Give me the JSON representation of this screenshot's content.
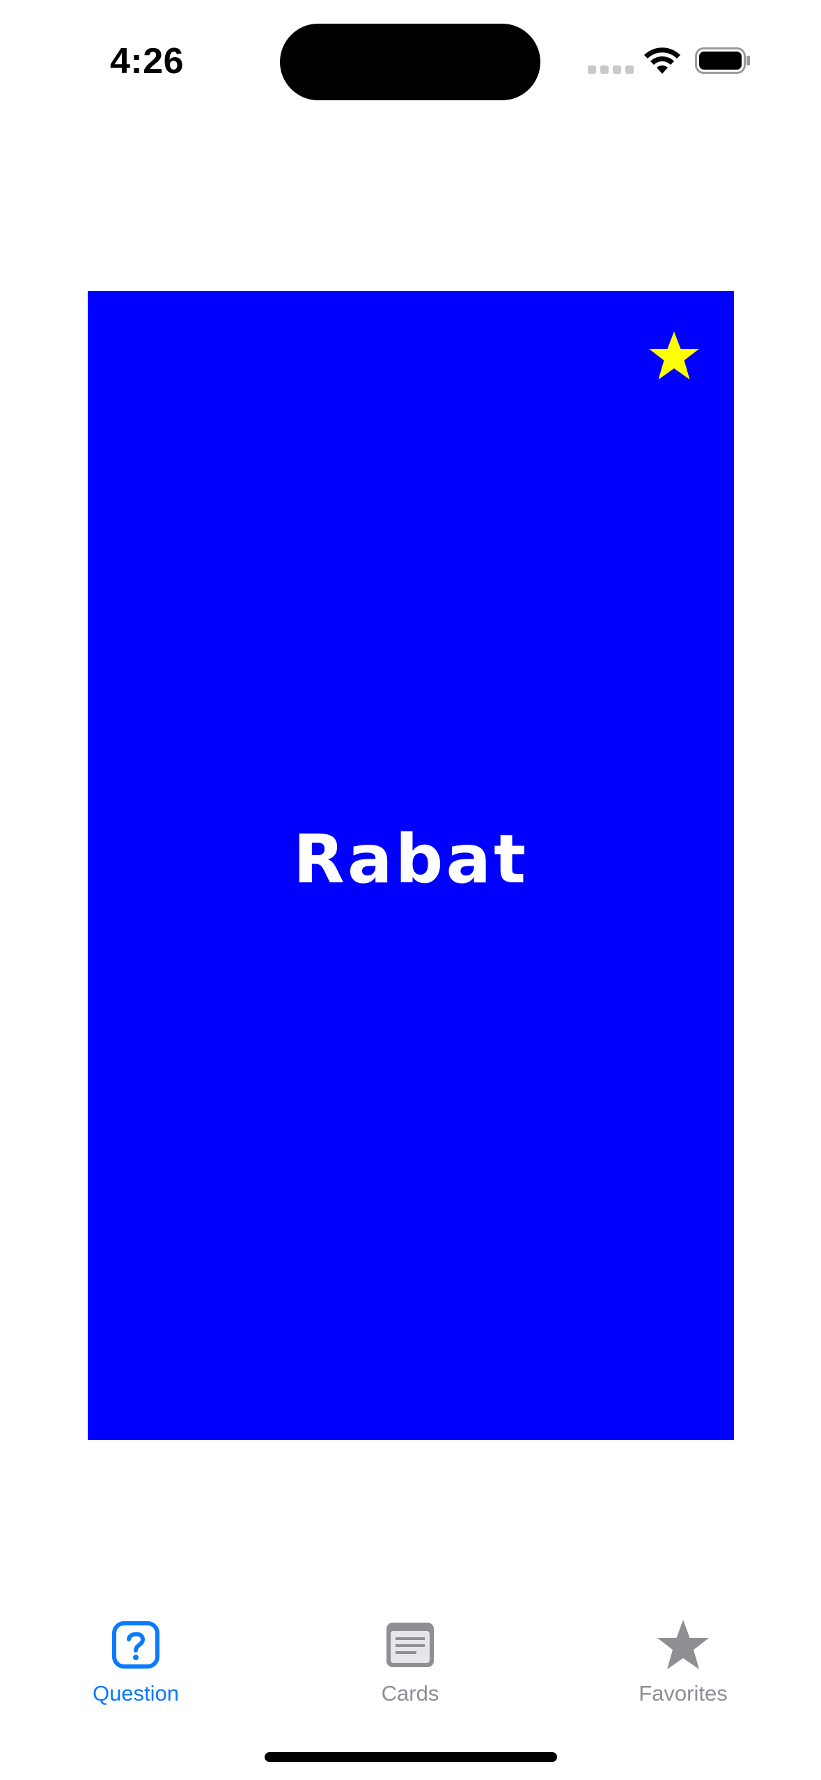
{
  "status_bar": {
    "time": "4:26"
  },
  "card": {
    "word": "Rabat",
    "background_color": "#0000ff",
    "favorite_icon": "star-icon",
    "favorite_color": "#ffff00",
    "favorited": true
  },
  "tabbar": {
    "active_color": "#0a7aff",
    "inactive_color": "#8e8e93",
    "tabs": [
      {
        "label": "Question",
        "icon": "question-square-icon",
        "active": true
      },
      {
        "label": "Cards",
        "icon": "list-card-icon",
        "active": false
      },
      {
        "label": "Favorites",
        "icon": "star-icon",
        "active": false
      }
    ]
  }
}
